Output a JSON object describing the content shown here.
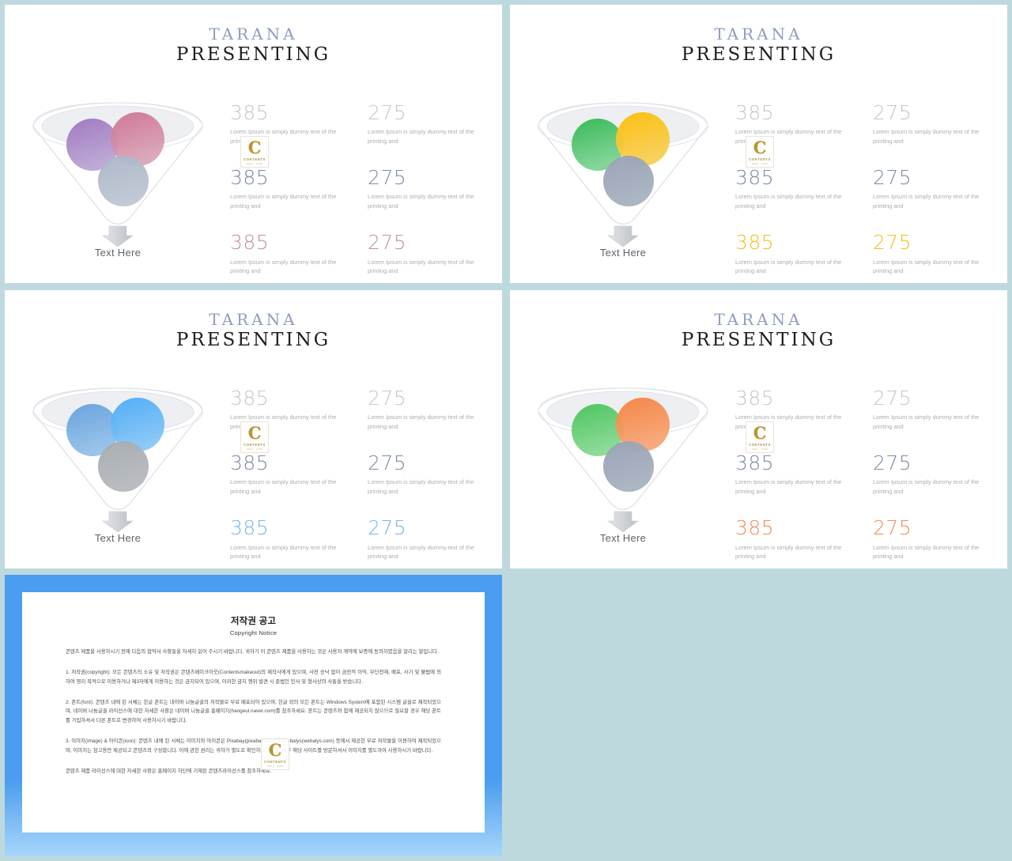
{
  "theme": {
    "background": "#bed9de",
    "panel_background": "#ffffff",
    "brand_color": "#8e9cc0",
    "notice_border": "#4a9df0",
    "tone_light": "#c2c6cb",
    "tone_slate": "#7d8aa3"
  },
  "watermark": {
    "letter": "C",
    "line1": "CONTENTS",
    "line2": "MALL . COM",
    "name": "contents-watermark-logo"
  },
  "slides": [
    {
      "id": "slide-top-left",
      "title": "TARANA",
      "subtitle": "PRESENTING",
      "funnel_label": "Text Here",
      "accent": "#c08fa6",
      "circles": [
        {
          "name": "circle-left",
          "color": "#9b72bd"
        },
        {
          "name": "circle-right",
          "color": "#cd6f91"
        },
        {
          "name": "circle-bottom",
          "color": "#a8b3c6"
        }
      ],
      "stats": [
        {
          "value": "385",
          "tone": "light",
          "desc": "Lorem Ipsum is simply dummy text of the printing and"
        },
        {
          "value": "275",
          "tone": "light",
          "desc": "Lorem Ipsum is simply dummy text of the printing and"
        },
        {
          "value": "385",
          "tone": "slate",
          "desc": "Lorem Ipsum is simply dummy text of the printing and"
        },
        {
          "value": "275",
          "tone": "slate",
          "desc": "Lorem Ipsum is simply dummy text of the printing and"
        },
        {
          "value": "385",
          "tone": "accent",
          "desc": "Lorem Ipsum is simply dummy text of the printing and"
        },
        {
          "value": "275",
          "tone": "accent",
          "desc": "Lorem Ipsum is simply dummy text of the printing and"
        }
      ]
    },
    {
      "id": "slide-top-right",
      "title": "TARANA",
      "subtitle": "PRESENTING",
      "funnel_label": "Text Here",
      "accent": "#f2c019",
      "circles": [
        {
          "name": "circle-left",
          "color": "#3dbf5c"
        },
        {
          "name": "circle-right",
          "color": "#fbbf09"
        },
        {
          "name": "circle-bottom",
          "color": "#9ba6b8"
        }
      ],
      "stats": [
        {
          "value": "385",
          "tone": "light",
          "desc": "Lorem Ipsum is simply dummy text of the printing and"
        },
        {
          "value": "275",
          "tone": "light",
          "desc": "Lorem Ipsum is simply dummy text of the printing and"
        },
        {
          "value": "385",
          "tone": "slate",
          "desc": "Lorem Ipsum is simply dummy text of the printing and"
        },
        {
          "value": "275",
          "tone": "slate",
          "desc": "Lorem Ipsum is simply dummy text of the printing and"
        },
        {
          "value": "385",
          "tone": "accent",
          "desc": "Lorem Ipsum is simply dummy text of the printing and"
        },
        {
          "value": "275",
          "tone": "accent",
          "desc": "Lorem Ipsum is simply dummy text of the printing and"
        }
      ]
    },
    {
      "id": "slide-bottom-left",
      "title": "TARANA",
      "subtitle": "PRESENTING",
      "funnel_label": "Text Here",
      "accent": "#78b6ea",
      "circles": [
        {
          "name": "circle-left",
          "color": "#6aa8e0"
        },
        {
          "name": "circle-right",
          "color": "#56b0f5"
        },
        {
          "name": "circle-bottom",
          "color": "#a9aeb3"
        }
      ],
      "stats": [
        {
          "value": "385",
          "tone": "light",
          "desc": "Lorem Ipsum is simply dummy text of the printing and"
        },
        {
          "value": "275",
          "tone": "light",
          "desc": "Lorem Ipsum is simply dummy text of the printing and"
        },
        {
          "value": "385",
          "tone": "slate",
          "desc": "Lorem Ipsum is simply dummy text of the printing and"
        },
        {
          "value": "275",
          "tone": "slate",
          "desc": "Lorem Ipsum is simply dummy text of the printing and"
        },
        {
          "value": "385",
          "tone": "accent",
          "desc": "Lorem Ipsum is simply dummy text of the printing and"
        },
        {
          "value": "275",
          "tone": "accent",
          "desc": "Lorem Ipsum is simply dummy text of the printing and"
        }
      ]
    },
    {
      "id": "slide-bottom-right",
      "title": "TARANA",
      "subtitle": "PRESENTING",
      "funnel_label": "Text Here",
      "accent": "#ef8d54",
      "circles": [
        {
          "name": "circle-left",
          "color": "#4fc45e"
        },
        {
          "name": "circle-right",
          "color": "#f4844a"
        },
        {
          "name": "circle-bottom",
          "color": "#9ba6b8"
        }
      ],
      "stats": [
        {
          "value": "385",
          "tone": "light",
          "desc": "Lorem Ipsum is simply dummy text of the printing and"
        },
        {
          "value": "275",
          "tone": "light",
          "desc": "Lorem Ipsum is simply dummy text of the printing and"
        },
        {
          "value": "385",
          "tone": "slate",
          "desc": "Lorem Ipsum is simply dummy text of the printing and"
        },
        {
          "value": "275",
          "tone": "slate",
          "desc": "Lorem Ipsum is simply dummy text of the printing and"
        },
        {
          "value": "385",
          "tone": "accent",
          "desc": "Lorem Ipsum is simply dummy text of the printing and"
        },
        {
          "value": "275",
          "tone": "accent",
          "desc": "Lorem Ipsum is simply dummy text of the printing and"
        }
      ]
    }
  ],
  "notice": {
    "heading_ko": "저작권 공고",
    "heading_en": "Copyright Notice",
    "intro": "콘텐츠 제품을 사용하시기 전에 다음의 협약서 사항들을 자세히 읽어 주시기 바랍니다. 귀하가 이 콘텐츠 제품을 사용하는 것은 사용자 계약에 보증에 동의하였음을 알리는 말입니다.",
    "item1": "1. 저작권(copyright): 모든 콘텐츠의 소유 및 저작권은 콘텐츠메이크아웃(Contentsmakeout)의 제작사에게 있으며, 사전 승낙 없이 금전적 이익, 무단전재, 배포, 사기 및 불법에 의하여 영리 목적으로 이용하거나 제3자에게 이용하는 것은 금지되어 있으며, 이러한 금지 행위 발견 시 준법인 민사 및 형사상의 사통을 받습니다.",
    "item2": "2. 폰트(font): 콘텐츠 내에 된 서체는 한글 폰트는 네이버 나눔글꼴의 저작물로 무료 배포되어 있으며, 한글 외의 모든 폰트는 Windows System에 포함된 시스템 글꼴로 제작되었으며, 네이버 나눔글꼴 라이선스에 대한 자세한 사항은 네이버 나눔글꼴 홈페이지(hangeul.naver.com)를 참조하세요. 폰트는 콘텐츠와 함께 제공되지 않으므로 필요할 경우 해당 폰트를 가입하셔서 다른 폰트로 변경하여 사용하시기 바랍니다.",
    "item3": "3. 이미지(image) & 아이콘(icon): 콘텐츠 내에 된 서체는 이미지와 아이콘은 Pixabay(pixabay.com)와 Webalys(webalys.com) 등에서 제공한 무료 저작물을 이용하여 제작되었으며, 이미지는 참고용만 제공되고 콘텐츠의 구성합니다. 이에 관한 권리는 귀하가 별도로 확인하고 필요할 경우 해당 사이트를 방문하셔서 이미지를 별도하여 사용하시기 바랍니다.",
    "footer": "콘텐츠 제품 라이선스에 대한 자세한 사항은 홈페이지 하단에 기재된 콘텐츠라이선스를 참조하세요."
  }
}
